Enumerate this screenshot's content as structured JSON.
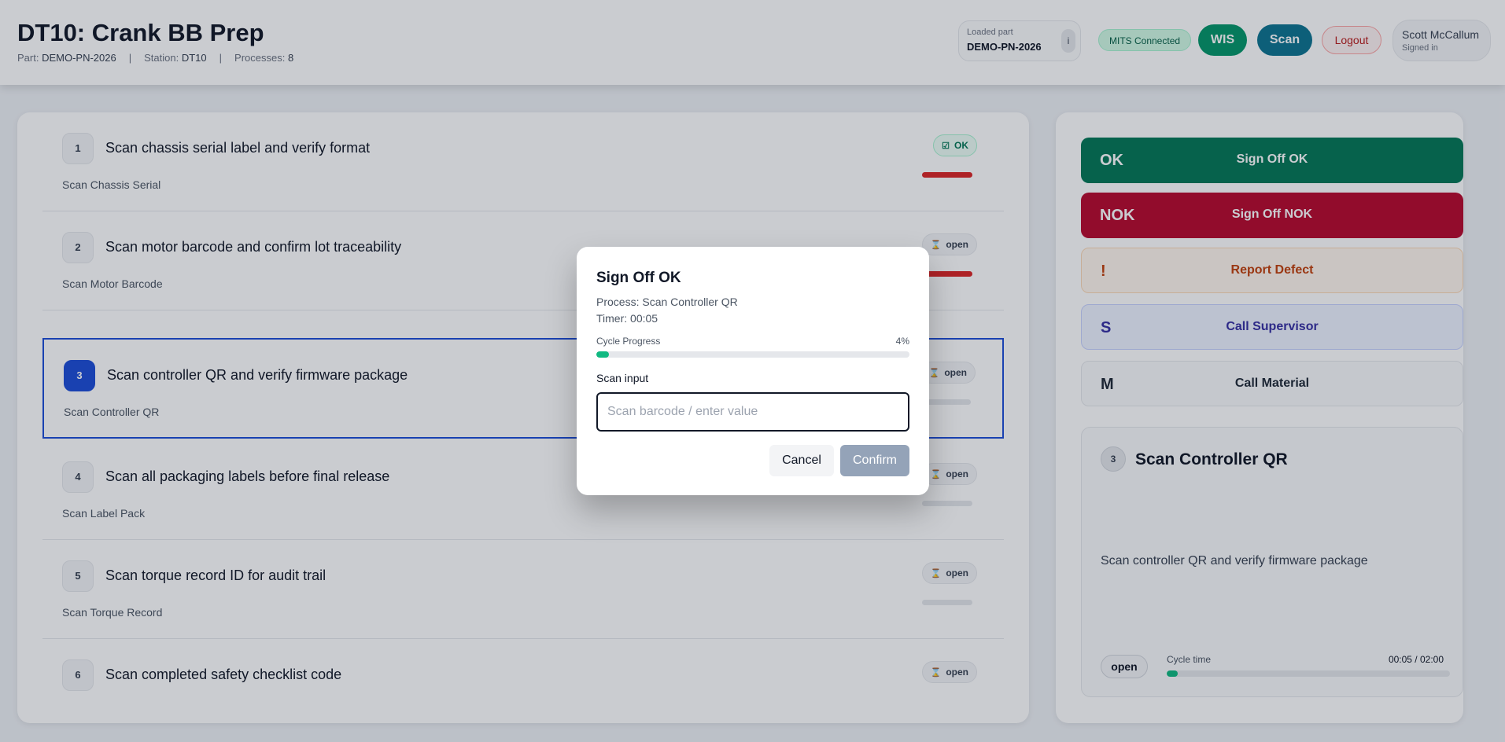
{
  "header": {
    "title": "DT10: Crank BB Prep",
    "part_label": "Part:",
    "part_value": "DEMO-PN-2026",
    "station_label": "Station:",
    "station_value": "DT10",
    "processes_label": "Processes:",
    "processes_value": "8",
    "separator": "|",
    "loaded_part_label": "Loaded part",
    "loaded_part_value": "DEMO-PN-2026",
    "info_icon": "i",
    "mits_status": "MITS Connected",
    "wis_label": "WIS",
    "scan_label": "Scan",
    "logout_label": "Logout",
    "user_name": "Scott McCallum",
    "user_status": "Signed in"
  },
  "processes": [
    {
      "num": "1",
      "title": "Scan chassis serial label and verify format",
      "subtitle": "Scan Chassis Serial",
      "status": "OK",
      "status_icon": "checkbox-icon",
      "bar": "red"
    },
    {
      "num": "2",
      "title": "Scan motor barcode and confirm lot traceability",
      "subtitle": "Scan Motor Barcode",
      "status": "open",
      "status_icon": "hourglass-icon",
      "bar": "red"
    },
    {
      "num": "3",
      "title": "Scan controller QR and verify firmware package",
      "subtitle": "Scan Controller QR",
      "status": "open",
      "status_icon": "hourglass-icon",
      "bar": "gray",
      "active": true
    },
    {
      "num": "4",
      "title": "Scan all packaging labels before final release",
      "subtitle": "Scan Label Pack",
      "status": "open",
      "status_icon": "hourglass-icon",
      "bar": "gray"
    },
    {
      "num": "5",
      "title": "Scan torque record ID for audit trail",
      "subtitle": "Scan Torque Record",
      "status": "open",
      "status_icon": "hourglass-icon",
      "bar": "gray"
    },
    {
      "num": "6",
      "title": "Scan completed safety checklist code",
      "subtitle": "",
      "status": "open",
      "status_icon": "hourglass-icon",
      "bar": "none"
    }
  ],
  "actions": {
    "ok": {
      "key": "OK",
      "label": "Sign Off OK",
      "color": "#047857"
    },
    "nok": {
      "key": "NOK",
      "label": "Sign Off NOK",
      "color": "#b80a2e"
    },
    "defect": {
      "key": "!",
      "label": "Report Defect"
    },
    "supervisor": {
      "key": "S",
      "label": "Call Supervisor"
    },
    "material": {
      "key": "M",
      "label": "Call Material"
    }
  },
  "detail": {
    "num": "3",
    "title": "Scan Controller QR",
    "description": "Scan controller QR and verify firmware package",
    "status": "open",
    "cycle_label": "Cycle time",
    "cycle_value": "00:05 / 02:00",
    "cycle_progress_pct": 4
  },
  "modal": {
    "title": "Sign Off OK",
    "process": "Process: Scan Controller QR",
    "timer": "Timer: 00:05",
    "progress_label": "Cycle Progress",
    "progress_value": "4%",
    "progress_pct": 4,
    "scan_label": "Scan input",
    "scan_placeholder": "Scan barcode / enter value",
    "scan_value": "",
    "cancel_label": "Cancel",
    "confirm_label": "Confirm"
  }
}
